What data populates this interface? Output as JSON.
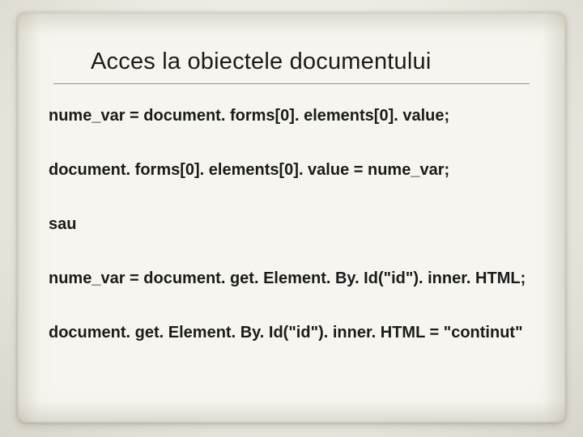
{
  "slide": {
    "title": "Acces la obiectele documentului",
    "lines": [
      "nume_var = document. forms[0]. elements[0]. value;",
      "document. forms[0]. elements[0]. value = nume_var;",
      "sau",
      "nume_var = document. get. Element. By. Id(\"id\"). inner. HTML;",
      "document. get. Element. By. Id(\"id\"). inner. HTML = \"continut\""
    ]
  }
}
